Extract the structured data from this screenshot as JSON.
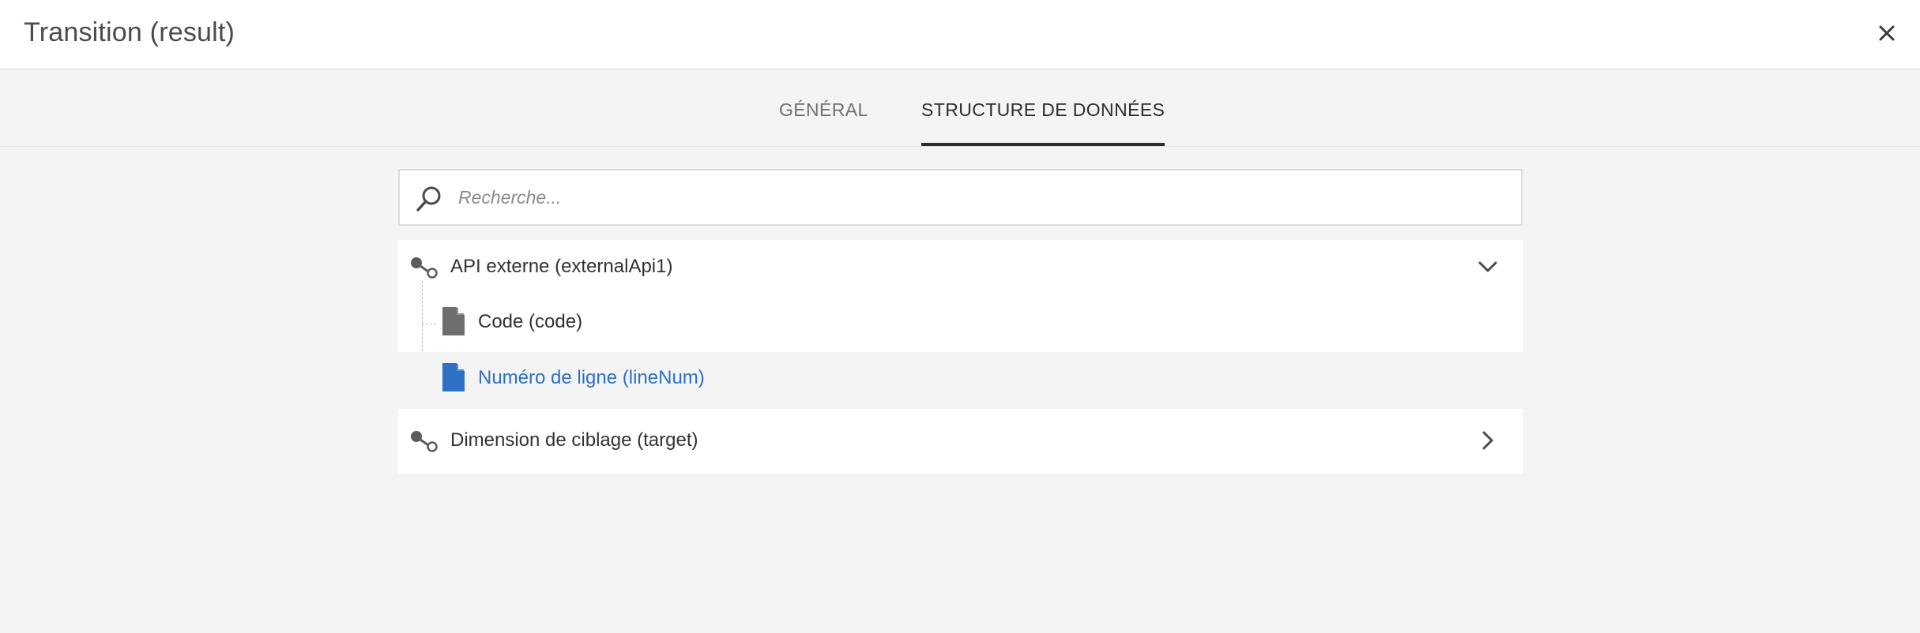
{
  "dialog": {
    "title": "Transition (result)"
  },
  "tabs": [
    {
      "label": "GÉNÉRAL",
      "active": false
    },
    {
      "label": "STRUCTURE DE DONNÉES",
      "active": true
    }
  ],
  "search": {
    "placeholder": "Recherche...",
    "value": ""
  },
  "tree": {
    "nodes": [
      {
        "label": "API externe (externalApi1)",
        "icon": "link-node-icon",
        "expanded": true,
        "children": [
          {
            "label": "Code (code)",
            "icon": "file-icon",
            "selected": false
          },
          {
            "label": "Numéro de ligne (lineNum)",
            "icon": "file-icon",
            "selected": true
          }
        ]
      },
      {
        "label": "Dimension de ciblage (target)",
        "icon": "link-node-icon",
        "expanded": false,
        "children": []
      }
    ]
  },
  "colors": {
    "selected_text": "#2d70c4",
    "selected_icon": "#2d70c4",
    "file_icon": "#6e6e6e",
    "background": "#f4f4f4"
  }
}
